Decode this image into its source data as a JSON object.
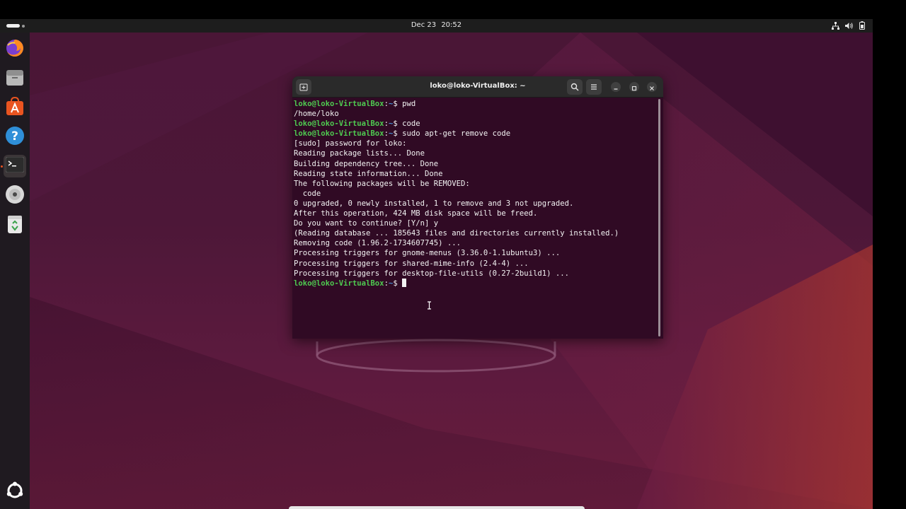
{
  "topbar": {
    "date": "Dec 23",
    "time": "20:52",
    "icons": [
      "network-icon",
      "volume-icon",
      "battery-icon"
    ]
  },
  "dock": {
    "items": [
      {
        "name": "firefox-icon"
      },
      {
        "name": "files-icon"
      },
      {
        "name": "app-center-icon"
      },
      {
        "name": "help-icon"
      },
      {
        "name": "terminal-icon",
        "active": true
      },
      {
        "name": "disc-icon"
      },
      {
        "name": "trash-icon"
      },
      {
        "name": "show-apps-icon"
      }
    ]
  },
  "terminal": {
    "title": "loko@loko-VirtualBox: ~",
    "lines": [
      {
        "prompt": "loko@loko-VirtualBox",
        "sep": ":",
        "path": "~",
        "sym": "$ ",
        "cmd": "pwd"
      },
      {
        "text": "/home/loko"
      },
      {
        "prompt": "loko@loko-VirtualBox",
        "sep": ":",
        "path": "~",
        "sym": "$ ",
        "cmd": "code"
      },
      {
        "prompt": "loko@loko-VirtualBox",
        "sep": ":",
        "path": "~",
        "sym": "$ ",
        "cmd": "sudo apt-get remove code"
      },
      {
        "text": "[sudo] password for loko:"
      },
      {
        "text": "Reading package lists... Done"
      },
      {
        "text": "Building dependency tree... Done"
      },
      {
        "text": "Reading state information... Done"
      },
      {
        "text": "The following packages will be REMOVED:"
      },
      {
        "text": "  code"
      },
      {
        "text": "0 upgraded, 0 newly installed, 1 to remove and 3 not upgraded."
      },
      {
        "text": "After this operation, 424 MB disk space will be freed."
      },
      {
        "text": "Do you want to continue? [Y/n] y"
      },
      {
        "text": "(Reading database ... 185643 files and directories currently installed.)"
      },
      {
        "text": "Removing code (1.96.2-1734607745) ..."
      },
      {
        "text": "Processing triggers for gnome-menus (3.36.0-1.1ubuntu3) ..."
      },
      {
        "text": "Processing triggers for shared-mime-info (2.4-4) ..."
      },
      {
        "text": "Processing triggers for desktop-file-utils (0.27-2build1) ..."
      },
      {
        "prompt": "loko@loko-VirtualBox",
        "sep": ":",
        "path": "~",
        "sym": "$ ",
        "cmd": "",
        "cursor": true
      }
    ]
  },
  "colors": {
    "terminal_bg": "#300a24",
    "prompt_green": "#4ec950",
    "path_blue": "#4a8fd8",
    "accent": "#e95420"
  }
}
